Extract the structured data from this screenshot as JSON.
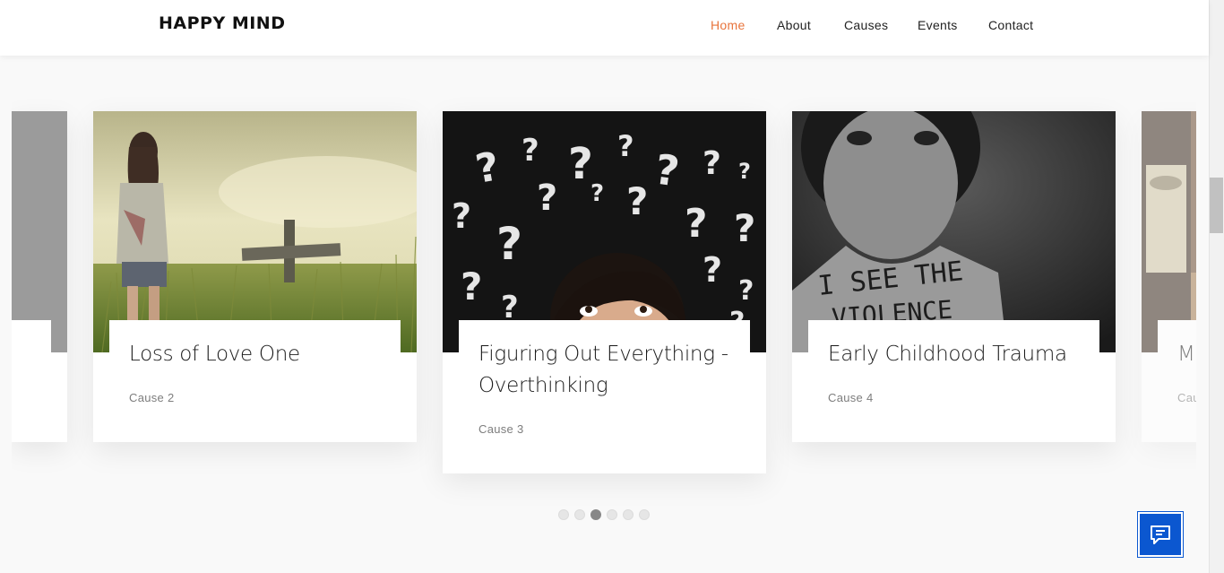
{
  "header": {
    "logo": "HAPPY MIND",
    "nav": [
      {
        "label": "Home",
        "active": true
      },
      {
        "label": "About",
        "active": false
      },
      {
        "label": "Causes",
        "active": false
      },
      {
        "label": "Events",
        "active": false
      },
      {
        "label": "Contact",
        "active": false
      }
    ]
  },
  "colors": {
    "accent": "#e8743c",
    "chat_button": "#0b57d0"
  },
  "carousel": {
    "cards": [
      {
        "title": "Loss of Love One",
        "subtitle": "Cause 2",
        "image": "woman-in-field-cross"
      },
      {
        "title": "Figuring Out Everything - Overthinking",
        "subtitle": "Cause 3",
        "image": "woman-with-question-marks"
      },
      {
        "title": "Early Childhood Trauma",
        "subtitle": "Cause 4",
        "image": "boy-i-see-the-violence"
      },
      {
        "title": "Mi",
        "subtitle": "Cau",
        "image": "bottles-partial"
      }
    ],
    "dots_total": 6,
    "active_dot": 3
  },
  "chat": {
    "icon": "chat-icon"
  }
}
